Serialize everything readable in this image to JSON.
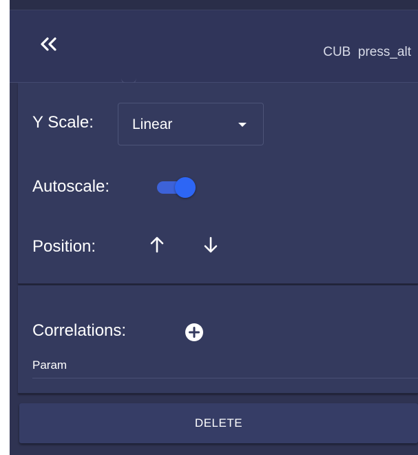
{
  "header": {
    "title": "CUB  press_alt"
  },
  "settings": {
    "y_scale_label": "Y Scale:",
    "y_scale_value": "Linear",
    "autoscale_label": "Autoscale:",
    "autoscale_on": true,
    "position_label": "Position:"
  },
  "correlations": {
    "label": "Correlations:",
    "param_label": "Param"
  },
  "actions": {
    "delete_label": "DELETE"
  },
  "colors": {
    "background": "#2f3352",
    "panel": "#343a5e",
    "accent": "#2d66f5"
  },
  "icons": {
    "collapse": "double-chevron-left-icon",
    "dropdown": "caret-down-icon",
    "move_up": "arrow-up-icon",
    "move_down": "arrow-down-icon",
    "add": "plus-circle-icon"
  }
}
